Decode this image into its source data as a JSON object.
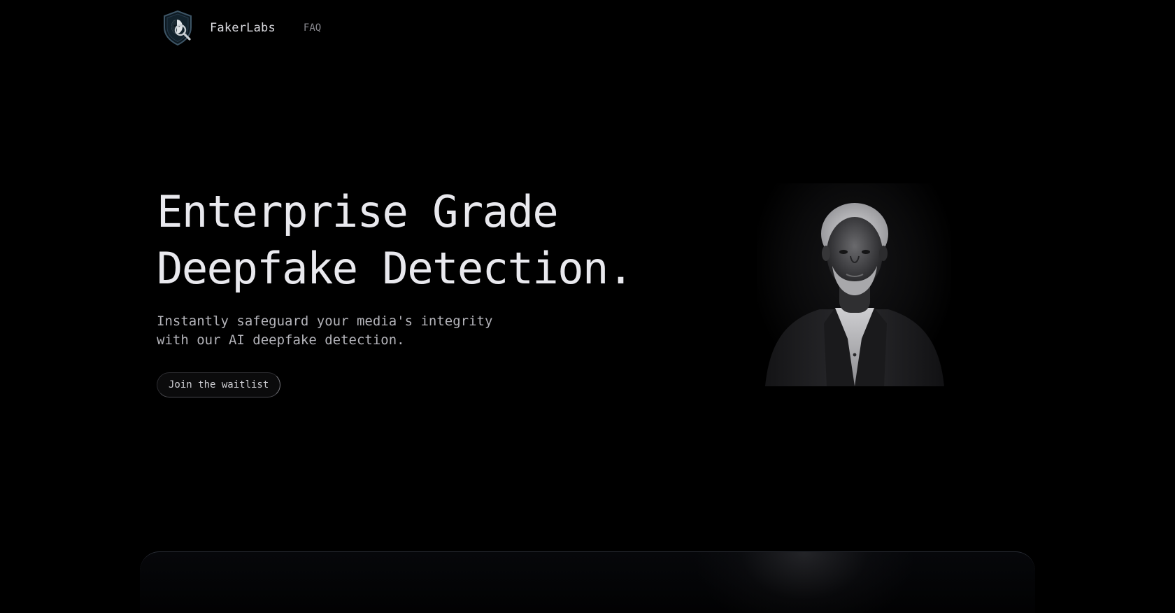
{
  "nav": {
    "brand": "FakerLabs",
    "links": [
      {
        "label": "FAQ"
      }
    ],
    "logo_icon": "shield-magnifier-icon"
  },
  "hero": {
    "title_line1": "Enterprise Grade",
    "title_line2": "Deepfake Detection.",
    "subtitle_line1": "Instantly safeguard your media's integrity",
    "subtitle_line2": "with our AI deepfake detection.",
    "cta_label": "Join the waitlist"
  },
  "colors": {
    "background": "#000000",
    "title": "#e9e9ee",
    "subtitle": "#b4b4ba",
    "nav_link": "#8a8a90",
    "card_border": "#2a2d36"
  }
}
